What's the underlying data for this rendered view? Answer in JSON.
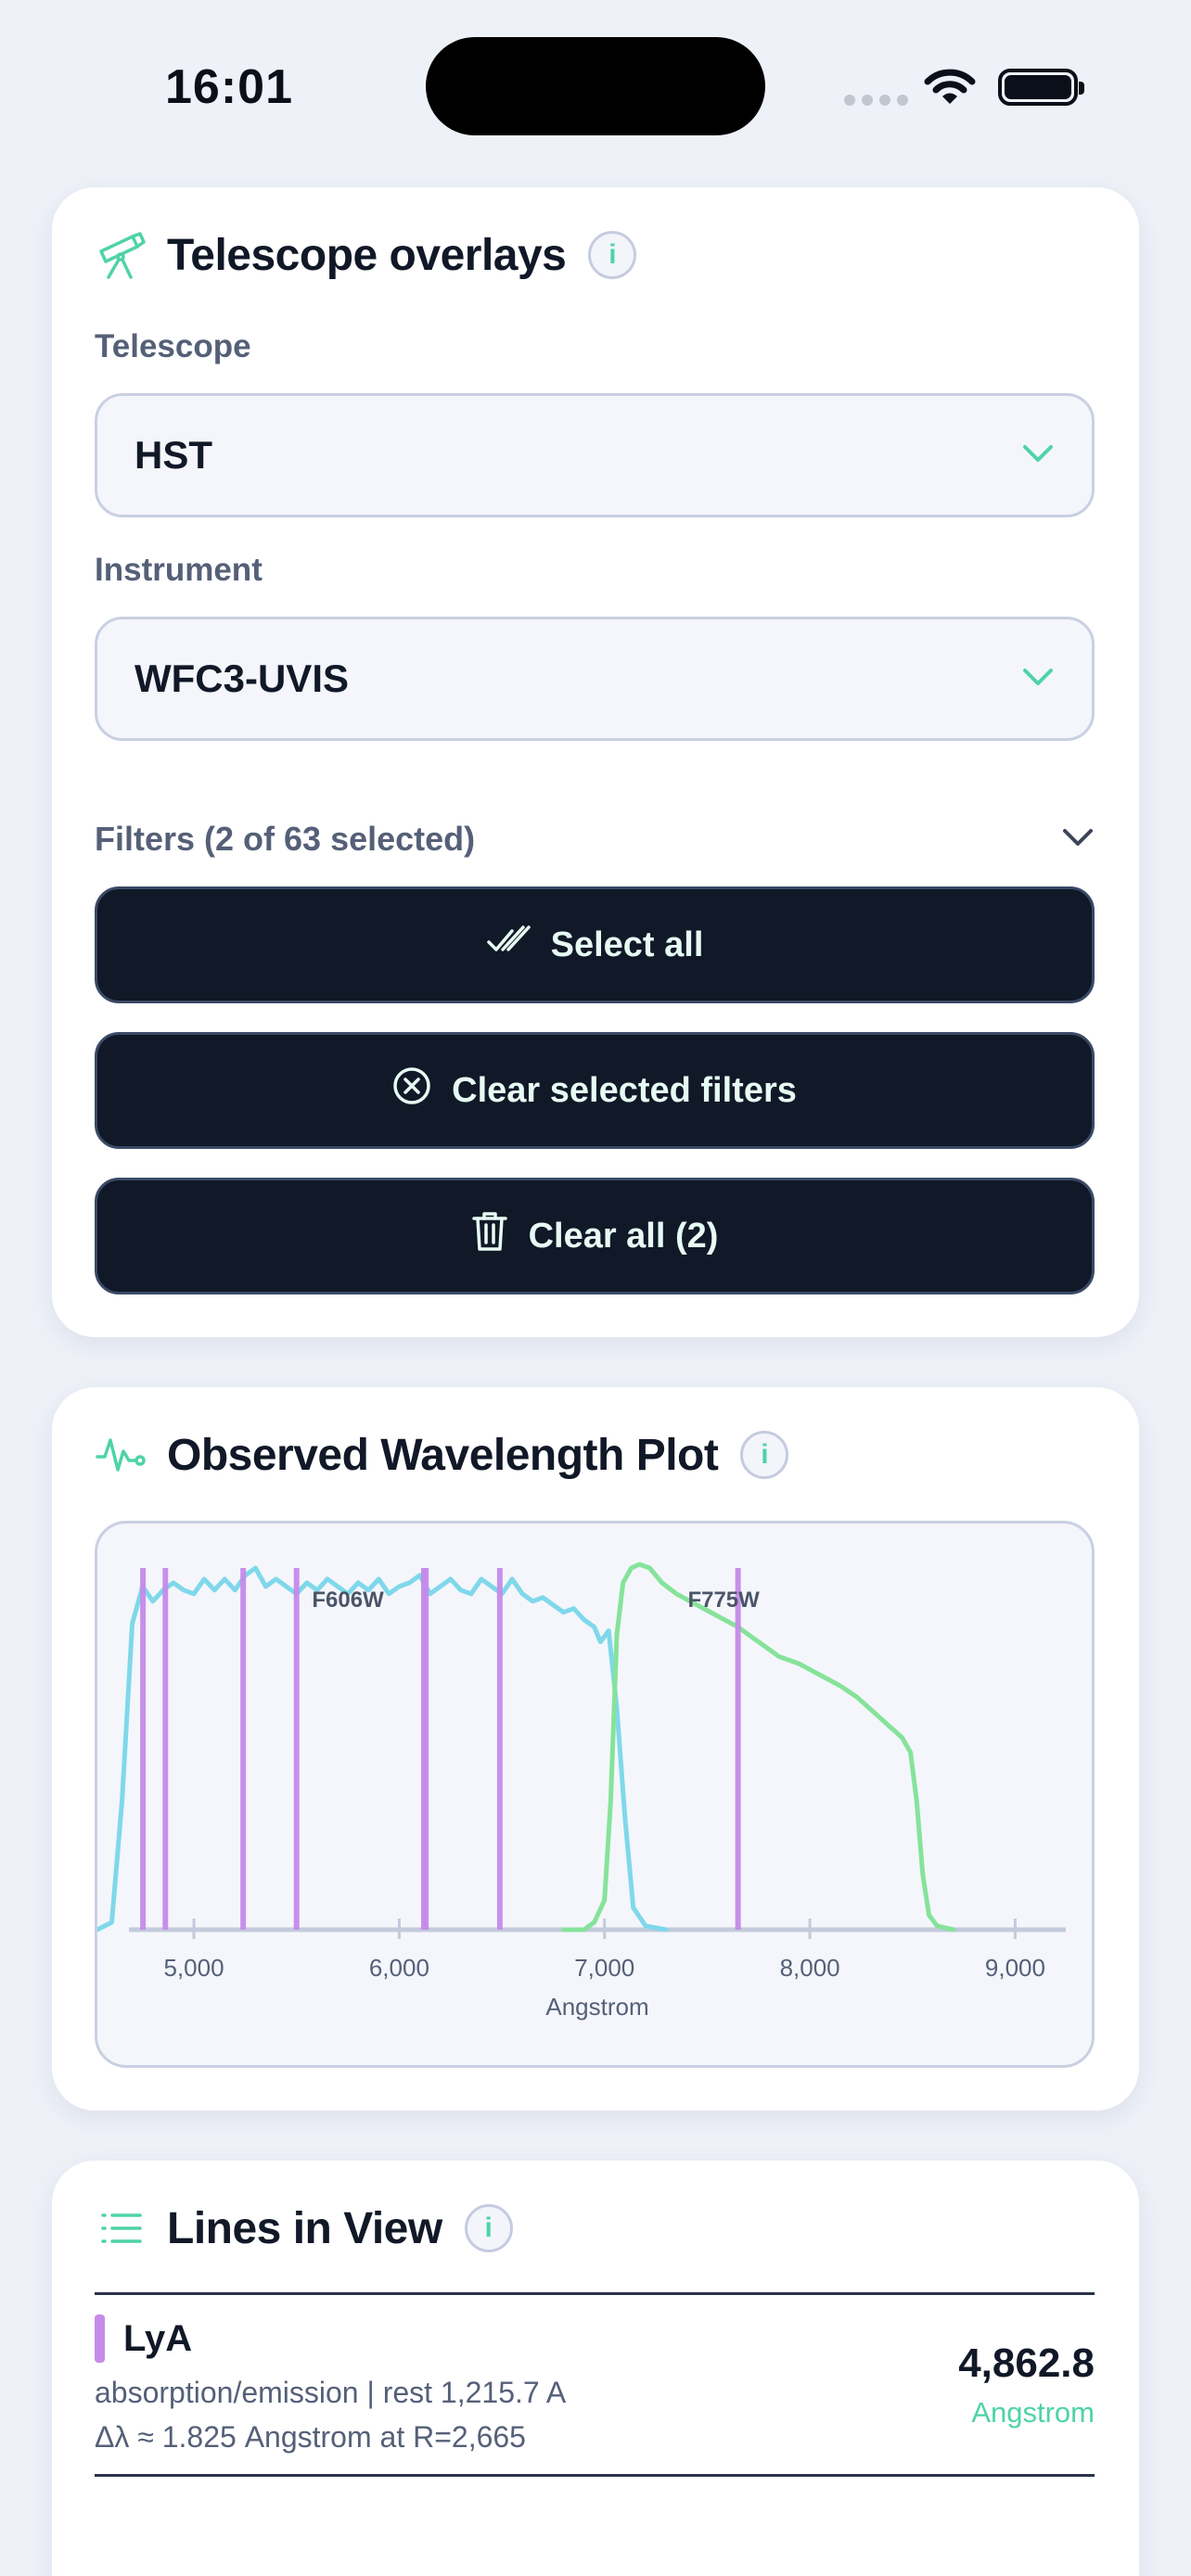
{
  "status_bar": {
    "time": "16:01"
  },
  "telescope_card": {
    "title": "Telescope overlays",
    "info": "i",
    "telescope_label": "Telescope",
    "telescope_value": "HST",
    "instrument_label": "Instrument",
    "instrument_value": "WFC3-UVIS",
    "filters_label": "Filters (2 of 63 selected)",
    "select_all_label": "Select all",
    "clear_selected_label": "Clear selected filters",
    "clear_all_label": "Clear all (2)"
  },
  "plot_card": {
    "title": "Observed Wavelength Plot",
    "info": "i"
  },
  "chart_data": {
    "type": "line",
    "title": "",
    "xlabel": "Angstrom",
    "ylabel": "",
    "xlim": [
      4530,
      9400
    ],
    "ylim": [
      0,
      1
    ],
    "x_ticks": [
      5000,
      6000,
      7000,
      8000,
      9000
    ],
    "x_tick_labels": [
      "5,000",
      "6,000",
      "7,000",
      "8,000",
      "9,000"
    ],
    "series": [
      {
        "name": "F606W",
        "color": "#7fd8ea",
        "points": [
          [
            4530,
            0.0
          ],
          [
            4600,
            0.02
          ],
          [
            4650,
            0.35
          ],
          [
            4700,
            0.83
          ],
          [
            4750,
            0.93
          ],
          [
            4800,
            0.89
          ],
          [
            4850,
            0.92
          ],
          [
            4900,
            0.94
          ],
          [
            4950,
            0.92
          ],
          [
            5000,
            0.91
          ],
          [
            5050,
            0.95
          ],
          [
            5100,
            0.92
          ],
          [
            5150,
            0.95
          ],
          [
            5200,
            0.92
          ],
          [
            5250,
            0.96
          ],
          [
            5300,
            0.98
          ],
          [
            5350,
            0.93
          ],
          [
            5400,
            0.95
          ],
          [
            5450,
            0.93
          ],
          [
            5500,
            0.91
          ],
          [
            5550,
            0.94
          ],
          [
            5600,
            0.92
          ],
          [
            5650,
            0.95
          ],
          [
            5700,
            0.93
          ],
          [
            5750,
            0.91
          ],
          [
            5800,
            0.94
          ],
          [
            5850,
            0.92
          ],
          [
            5900,
            0.95
          ],
          [
            5950,
            0.91
          ],
          [
            6000,
            0.93
          ],
          [
            6050,
            0.94
          ],
          [
            6100,
            0.96
          ],
          [
            6150,
            0.91
          ],
          [
            6200,
            0.93
          ],
          [
            6250,
            0.95
          ],
          [
            6300,
            0.92
          ],
          [
            6350,
            0.91
          ],
          [
            6400,
            0.95
          ],
          [
            6450,
            0.93
          ],
          [
            6500,
            0.91
          ],
          [
            6550,
            0.95
          ],
          [
            6600,
            0.91
          ],
          [
            6650,
            0.89
          ],
          [
            6700,
            0.9
          ],
          [
            6750,
            0.88
          ],
          [
            6800,
            0.86
          ],
          [
            6850,
            0.87
          ],
          [
            6900,
            0.84
          ],
          [
            6950,
            0.82
          ],
          [
            6980,
            0.78
          ],
          [
            7020,
            0.81
          ],
          [
            7060,
            0.6
          ],
          [
            7100,
            0.3
          ],
          [
            7140,
            0.06
          ],
          [
            7200,
            0.01
          ],
          [
            7300,
            0.0
          ]
        ]
      },
      {
        "name": "F775W",
        "color": "#86e39a",
        "points": [
          [
            6800,
            0.0
          ],
          [
            6900,
            0.0
          ],
          [
            6950,
            0.02
          ],
          [
            7000,
            0.08
          ],
          [
            7030,
            0.35
          ],
          [
            7060,
            0.8
          ],
          [
            7090,
            0.94
          ],
          [
            7130,
            0.98
          ],
          [
            7170,
            0.99
          ],
          [
            7220,
            0.98
          ],
          [
            7280,
            0.94
          ],
          [
            7350,
            0.91
          ],
          [
            7450,
            0.88
          ],
          [
            7550,
            0.85
          ],
          [
            7650,
            0.82
          ],
          [
            7750,
            0.78
          ],
          [
            7850,
            0.74
          ],
          [
            7950,
            0.72
          ],
          [
            8050,
            0.69
          ],
          [
            8150,
            0.66
          ],
          [
            8230,
            0.63
          ],
          [
            8310,
            0.59
          ],
          [
            8390,
            0.55
          ],
          [
            8450,
            0.52
          ],
          [
            8490,
            0.48
          ],
          [
            8520,
            0.35
          ],
          [
            8550,
            0.15
          ],
          [
            8580,
            0.04
          ],
          [
            8620,
            0.01
          ],
          [
            8700,
            0.0
          ]
        ]
      }
    ],
    "line_markers": [
      {
        "x": 4752,
        "color": "#c58bea"
      },
      {
        "x": 4861,
        "color": "#c58bea"
      },
      {
        "x": 5240,
        "color": "#c58bea"
      },
      {
        "x": 5500,
        "color": "#c58bea"
      },
      {
        "x": 6120,
        "color": "#c58bea"
      },
      {
        "x": 6130,
        "color": "#c58bea"
      },
      {
        "x": 6490,
        "color": "#c58bea"
      },
      {
        "x": 7650,
        "color": "#c58bea"
      }
    ],
    "annotations": [
      {
        "text": "F606W",
        "x": 5750,
        "y": 0.91
      },
      {
        "text": "F775W",
        "x": 7580,
        "y": 0.91
      }
    ],
    "grid": false,
    "legend": "none"
  },
  "lines_card": {
    "title": "Lines in View",
    "info": "i",
    "items": [
      {
        "name": "LyA",
        "meta1": "absorption/emission | rest 1,215.7 A",
        "meta2": "Δλ ≈ 1.825 Angstrom at R=2,665",
        "value": "4,862.8",
        "unit": "Angstrom"
      }
    ]
  }
}
